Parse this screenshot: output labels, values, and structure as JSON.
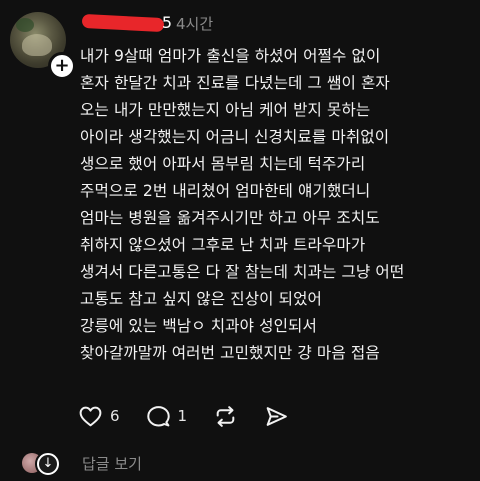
{
  "post": {
    "author_visible_suffix": "5",
    "time": "4시간",
    "lines": [
      "내가 9살때 엄마가 출신을 하셨어 어쩔수 없이",
      "혼자 한달간 치과 진료를 다녔는데 그 쌤이 혼자",
      "오는 내가 만만했는지 아님 케어 받지 못하는",
      "아이라 생각했는지 어금니 신경치료를 마취없이",
      "생으로 했어 아파서 몸부림 치는데 턱주가리",
      "주먹으로 2번 내리쳤어 엄마한테 얘기했더니",
      "엄마는 병원을 옮겨주시기만 하고 아무 조치도",
      "취하지 않으셨어 그후로 난 치과 트라우마가",
      "생겨서 다른고통은 다 잘 참는데 치과는 그냥 어떤",
      "고통도 참고 싶지 않은 진상이 되었어",
      "강릉에 있는 백남ㅇ 치과야 성인되서",
      "찾아갈까말까 여러번 고민했지만 걍 마음 접음"
    ]
  },
  "actions": {
    "like": {
      "icon": "heart-icon",
      "count": "6"
    },
    "comment": {
      "icon": "comment-icon",
      "count": "1"
    },
    "repost": {
      "icon": "repost-icon"
    },
    "share": {
      "icon": "send-icon"
    }
  },
  "replies": {
    "label": "답글 보기",
    "badge_glyph": "↓"
  },
  "add_badge_glyph": "+",
  "colors": {
    "background": "#101010",
    "text": "#f2f2f2",
    "muted": "#8a8a8a",
    "redaction": "#e8262a"
  }
}
